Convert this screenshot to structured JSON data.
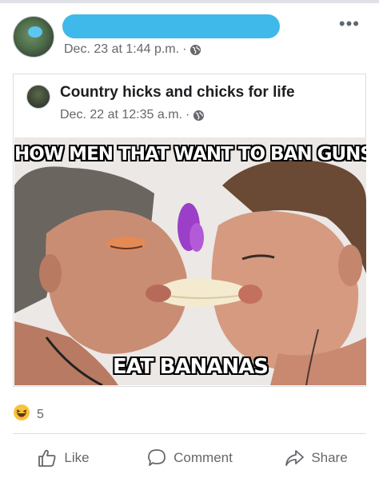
{
  "post": {
    "author_name": "",
    "timestamp": "Dec. 23 at 1:44 p.m.",
    "separator": "·",
    "privacy_icon": "globe-icon",
    "menu_icon": "more-options-icon"
  },
  "shared_post": {
    "group_name": "Country hicks and chicks for life",
    "timestamp": "Dec. 22 at 12:35 a.m.",
    "separator": "·",
    "privacy_icon": "globe-icon",
    "meme": {
      "top_text": "HOW MEN THAT WANT TO BAN GUNS",
      "bottom_text": "EAT BANANAS"
    }
  },
  "reactions": {
    "icon": "haha-reaction-icon",
    "count": "5"
  },
  "actions": [
    {
      "label": "Like",
      "icon": "thumbs-up-icon"
    },
    {
      "label": "Comment",
      "icon": "comment-icon"
    },
    {
      "label": "Share",
      "icon": "share-icon"
    }
  ],
  "colors": {
    "redaction": "#3fb8ea",
    "secondary_text": "#65676b",
    "border": "#dadde1"
  }
}
